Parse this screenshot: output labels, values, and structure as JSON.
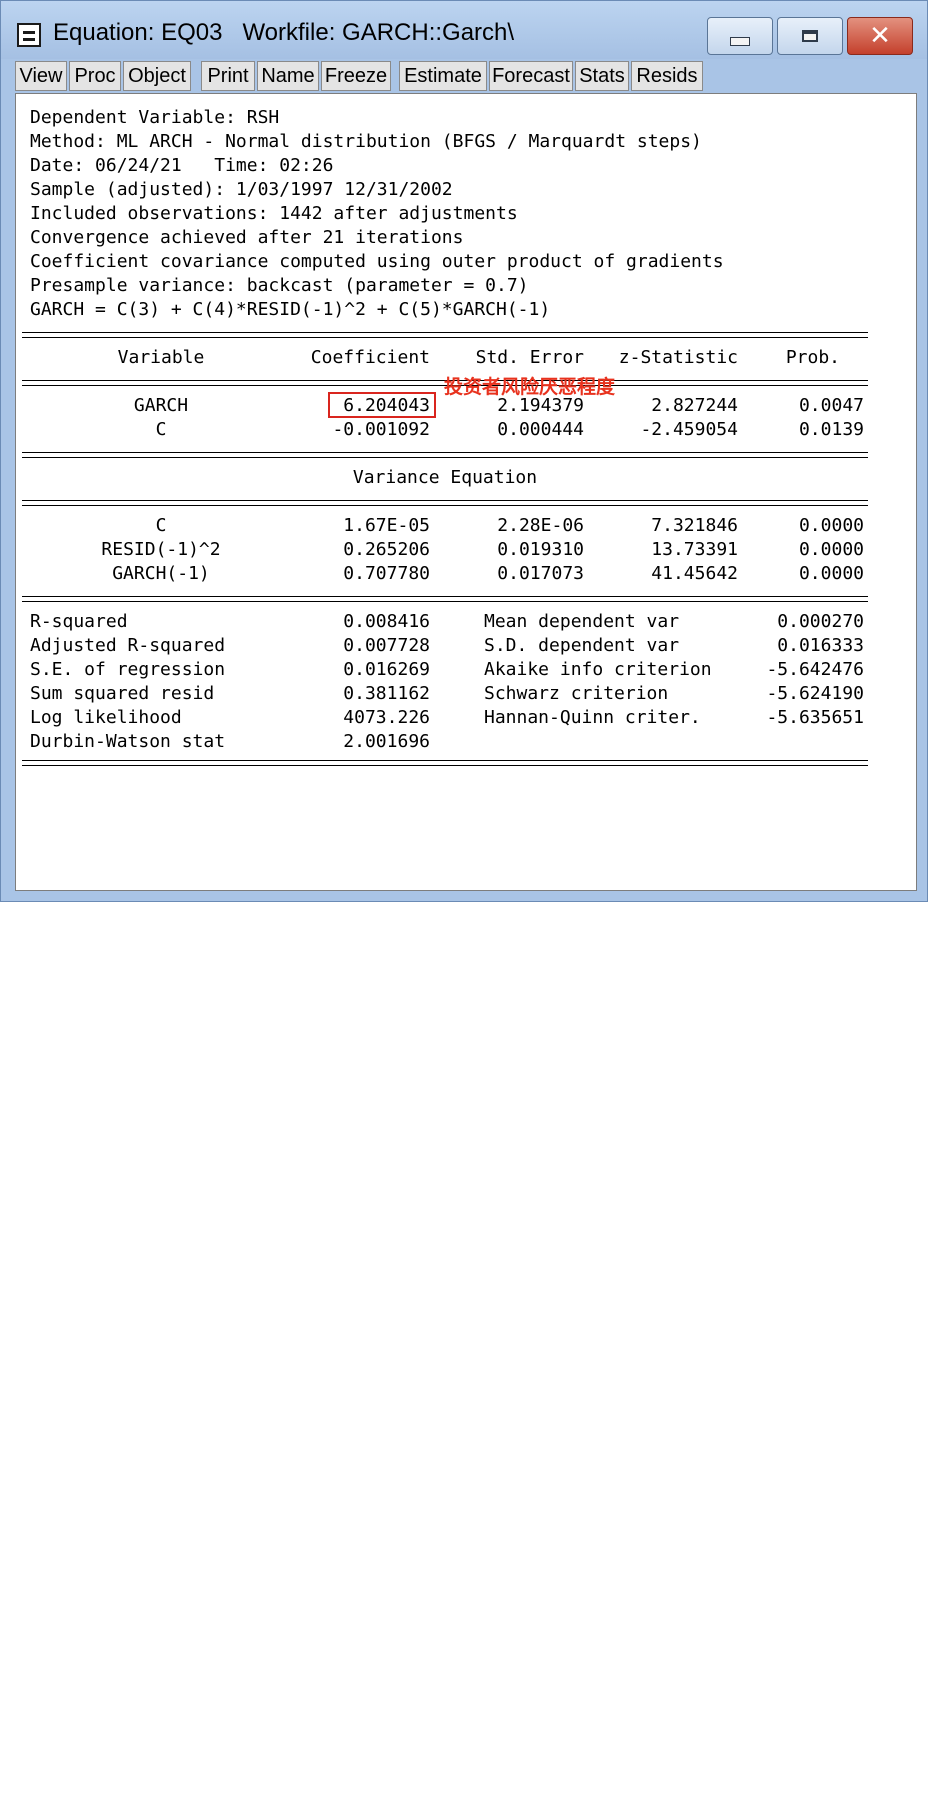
{
  "window": {
    "title": "Equation: EQ03   Workfile: GARCH::Garch\\",
    "system_icon": "equation-window-icon",
    "controls": [
      "minimize-icon",
      "maximize-icon",
      "close-icon"
    ],
    "colors": {
      "frame": "#a9c4e6",
      "close_button": "#c4402c"
    }
  },
  "toolbar": {
    "buttons": [
      "View",
      "Proc",
      "Object",
      "Print",
      "Name",
      "Freeze",
      "Estimate",
      "Forecast",
      "Stats",
      "Resids"
    ]
  },
  "header_lines": [
    "Dependent Variable: RSH",
    "Method: ML ARCH - Normal distribution (BFGS / Marquardt steps)",
    "Date: 06/24/21   Time: 02:26",
    "Sample (adjusted): 1/03/1997 12/31/2002",
    "Included observations: 1442 after adjustments",
    "Convergence achieved after 21 iterations",
    "Coefficient covariance computed using outer product of gradients",
    "Presample variance: backcast (parameter = 0.7)",
    "GARCH = C(3) + C(4)*RESID(-1)^2 + C(5)*GARCH(-1)"
  ],
  "table": {
    "columns": [
      "Variable",
      "Coefficient",
      "Std. Error",
      "z-Statistic",
      "Prob."
    ],
    "mean_rows": [
      [
        "GARCH",
        "6.204043",
        "2.194379",
        "2.827244",
        "0.0047"
      ],
      [
        "C",
        "-0.001092",
        "0.000444",
        "-2.459054",
        "0.0139"
      ]
    ],
    "variance_title": "Variance Equation",
    "variance_rows": [
      [
        "C",
        "1.67E-05",
        "2.28E-06",
        "7.321846",
        "0.0000"
      ],
      [
        "RESID(-1)^2",
        "0.265206",
        "0.019310",
        "13.73391",
        "0.0000"
      ],
      [
        "GARCH(-1)",
        "0.707780",
        "0.017073",
        "41.45642",
        "0.0000"
      ]
    ]
  },
  "stats": {
    "left": [
      [
        "R-squared",
        "0.008416"
      ],
      [
        "Adjusted R-squared",
        "0.007728"
      ],
      [
        "S.E. of regression",
        "0.016269"
      ],
      [
        "Sum squared resid",
        "0.381162"
      ],
      [
        "Log likelihood",
        "4073.226"
      ],
      [
        "Durbin-Watson stat",
        "2.001696"
      ]
    ],
    "right": [
      [
        "Mean dependent var",
        "0.000270"
      ],
      [
        "S.D. dependent var",
        "0.016333"
      ],
      [
        "Akaike info criterion",
        "-5.642476"
      ],
      [
        "Schwarz criterion",
        "-5.624190"
      ],
      [
        "Hannan-Quinn criter.",
        "-5.635651"
      ]
    ]
  },
  "annotation": {
    "text": "投资者风险厌恶程度",
    "color": "#e8321e"
  }
}
